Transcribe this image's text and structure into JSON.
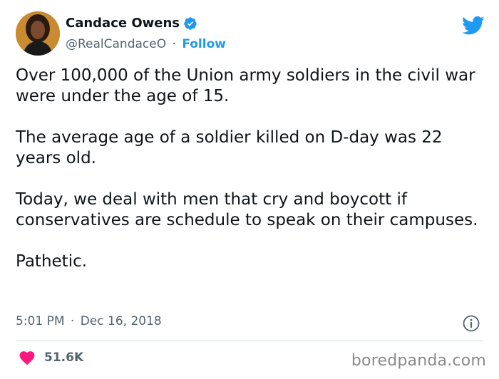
{
  "author": {
    "name": "Candace Owens",
    "handle": "@RealCandaceO",
    "separator": "·",
    "follow_label": "Follow"
  },
  "tweet": {
    "paragraphs": [
      "Over 100,000 of the Union army soldiers in the civil war were under the age of 15.",
      "The average age of a soldier killed on D-day was 22 years old.",
      "Today, we deal with men that cry and boycott if conservatives are schedule to speak on their campuses.",
      "Pathetic."
    ],
    "time": "5:01 PM",
    "date": "Dec 16, 2018",
    "meta_separator": "·"
  },
  "engagement": {
    "like_count": "51.6K"
  },
  "watermark": "boredpanda.com",
  "icons": {
    "verified": "verified-badge-icon",
    "twitter": "twitter-bird-icon",
    "info": "info-icon",
    "like": "heart-icon"
  },
  "colors": {
    "brand_blue": "#1d9bf0",
    "like_red": "#f91880",
    "muted_text": "#536471"
  }
}
